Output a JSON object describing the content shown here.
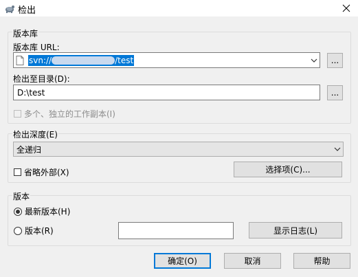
{
  "window": {
    "title": "检出"
  },
  "repository": {
    "group_label": "版本库",
    "url_label": "版本库 URL:",
    "url_prefix": "svn://",
    "url_suffix": "/test",
    "browse_label": "...",
    "checkout_dir_label": "检出至目录(D):",
    "checkout_dir_value": "D:\\test",
    "dir_browse_label": "...",
    "multiple_copies_label": "多个、独立的工作副本(I)"
  },
  "depth": {
    "group_label": "检出深度(E)",
    "selected": "全递归",
    "omit_externals_label": "省略外部(X)",
    "choose_items_label": "选择项(C)..."
  },
  "revision": {
    "group_label": "版本",
    "head_label": "最新版本(H)",
    "revision_label": "版本(R)",
    "revision_value": "",
    "show_log_label": "显示日志(L)"
  },
  "buttons": {
    "ok": "确定(O)",
    "cancel": "取消",
    "help": "帮助"
  }
}
